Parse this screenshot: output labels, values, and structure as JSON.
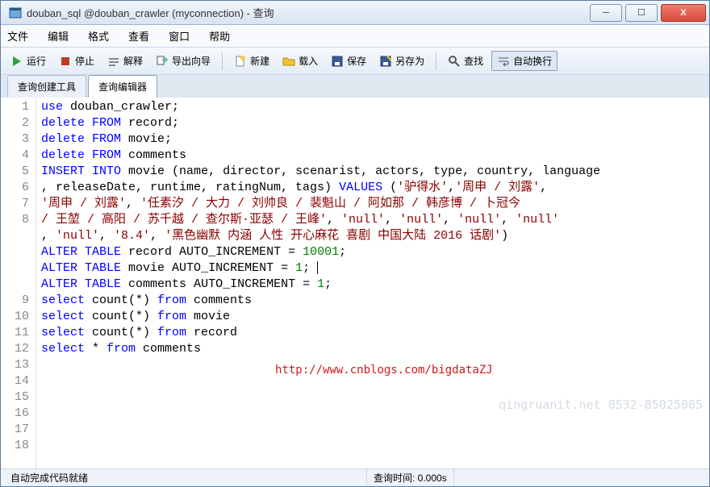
{
  "window": {
    "title": "douban_sql @douban_crawler (myconnection) - 查询"
  },
  "menu": {
    "file": "文件",
    "edit": "编辑",
    "format": "格式",
    "view": "查看",
    "window": "窗口",
    "help": "帮助"
  },
  "toolbar": {
    "run": "运行",
    "stop": "停止",
    "explain": "解释",
    "export_wizard": "导出向导",
    "new": "新建",
    "load": "载入",
    "save": "保存",
    "save_as": "另存为",
    "find": "查找",
    "auto_wrap": "自动换行"
  },
  "tabs": {
    "builder": "查询创建工具",
    "editor": "查询编辑器"
  },
  "code": {
    "lines": [
      [
        {
          "t": "kw",
          "v": "use"
        },
        {
          "t": "id",
          "v": " douban_crawler;"
        }
      ],
      [
        {
          "t": "kw",
          "v": "delete"
        },
        {
          "t": "id",
          "v": " "
        },
        {
          "t": "kw",
          "v": "FROM"
        },
        {
          "t": "id",
          "v": " record;"
        }
      ],
      [
        {
          "t": "kw",
          "v": "delete"
        },
        {
          "t": "id",
          "v": " "
        },
        {
          "t": "kw",
          "v": "FROM"
        },
        {
          "t": "id",
          "v": " movie;"
        }
      ],
      [
        {
          "t": "kw",
          "v": "delete"
        },
        {
          "t": "id",
          "v": " "
        },
        {
          "t": "kw",
          "v": "FROM"
        },
        {
          "t": "id",
          "v": " comments"
        }
      ],
      [
        {
          "t": "id",
          "v": ""
        }
      ],
      [
        {
          "t": "id",
          "v": ""
        }
      ],
      [
        {
          "t": "id",
          "v": ""
        }
      ],
      [
        {
          "t": "kw",
          "v": "INSERT"
        },
        {
          "t": "id",
          "v": " "
        },
        {
          "t": "kw",
          "v": "INTO"
        },
        {
          "t": "id",
          "v": " movie (name, director, scenarist, actors, type, country, language\n, releaseDate, runtime, ratingNum, tags) "
        },
        {
          "t": "kw",
          "v": "VALUES"
        },
        {
          "t": "id",
          "v": " ("
        },
        {
          "t": "str",
          "v": "'驴得水'"
        },
        {
          "t": "id",
          "v": ","
        },
        {
          "t": "str",
          "v": "'周申 / 刘露'"
        },
        {
          "t": "id",
          "v": ",\n"
        },
        {
          "t": "str",
          "v": "'周申 / 刘露'"
        },
        {
          "t": "id",
          "v": ", "
        },
        {
          "t": "str",
          "v": "'任素汐 / 大力 / 刘帅良 / 裴魁山 / 阿如那 / 韩彦博 / 卜冠今\n/ 王堃 / 高阳 / 苏千越 / 查尔斯·亚瑟 / 王峰'"
        },
        {
          "t": "id",
          "v": ", "
        },
        {
          "t": "str",
          "v": "'null'"
        },
        {
          "t": "id",
          "v": ", "
        },
        {
          "t": "str",
          "v": "'null'"
        },
        {
          "t": "id",
          "v": ", "
        },
        {
          "t": "str",
          "v": "'null'"
        },
        {
          "t": "id",
          "v": ", "
        },
        {
          "t": "str",
          "v": "'null'"
        },
        {
          "t": "id",
          "v": "\n, "
        },
        {
          "t": "str",
          "v": "'null'"
        },
        {
          "t": "id",
          "v": ", "
        },
        {
          "t": "str",
          "v": "'8.4'"
        },
        {
          "t": "id",
          "v": ", "
        },
        {
          "t": "str",
          "v": "'黑色幽默 内涵 人性 开心麻花 喜剧 中国大陆 2016 话剧'"
        },
        {
          "t": "id",
          "v": ")"
        }
      ],
      [
        {
          "t": "id",
          "v": ""
        }
      ],
      [
        {
          "t": "kw",
          "v": "ALTER"
        },
        {
          "t": "id",
          "v": " "
        },
        {
          "t": "kw",
          "v": "TABLE"
        },
        {
          "t": "id",
          "v": " record AUTO_INCREMENT = "
        },
        {
          "t": "num",
          "v": "10001"
        },
        {
          "t": "id",
          "v": ";"
        }
      ],
      [
        {
          "t": "kw",
          "v": "ALTER"
        },
        {
          "t": "id",
          "v": " "
        },
        {
          "t": "kw",
          "v": "TABLE"
        },
        {
          "t": "id",
          "v": " movie AUTO_INCREMENT = "
        },
        {
          "t": "num",
          "v": "1"
        },
        {
          "t": "id",
          "v": "; "
        },
        {
          "t": "cursor",
          "v": ""
        }
      ],
      [
        {
          "t": "kw",
          "v": "ALTER"
        },
        {
          "t": "id",
          "v": " "
        },
        {
          "t": "kw",
          "v": "TABLE"
        },
        {
          "t": "id",
          "v": " comments AUTO_INCREMENT = "
        },
        {
          "t": "num",
          "v": "1"
        },
        {
          "t": "id",
          "v": ";"
        }
      ],
      [
        {
          "t": "id",
          "v": ""
        }
      ],
      [
        {
          "t": "kw",
          "v": "select"
        },
        {
          "t": "id",
          "v": " count(*) "
        },
        {
          "t": "kw",
          "v": "from"
        },
        {
          "t": "id",
          "v": " comments"
        }
      ],
      [
        {
          "t": "kw",
          "v": "select"
        },
        {
          "t": "id",
          "v": " count(*) "
        },
        {
          "t": "kw",
          "v": "from"
        },
        {
          "t": "id",
          "v": " movie"
        }
      ],
      [
        {
          "t": "kw",
          "v": "select"
        },
        {
          "t": "id",
          "v": " count(*) "
        },
        {
          "t": "kw",
          "v": "from"
        },
        {
          "t": "id",
          "v": " record"
        }
      ],
      [
        {
          "t": "id",
          "v": ""
        }
      ],
      [
        {
          "t": "kw",
          "v": "select"
        },
        {
          "t": "id",
          "v": " * "
        },
        {
          "t": "kw",
          "v": "from"
        },
        {
          "t": "id",
          "v": " comments"
        }
      ]
    ],
    "line_numbers": [
      "1",
      "2",
      "3",
      "4",
      "5",
      "6",
      "7",
      "8",
      "",
      "",
      "",
      "",
      "9",
      "10",
      "11",
      "12",
      "13",
      "14",
      "15",
      "16",
      "17",
      "18"
    ]
  },
  "watermark": {
    "url": "http://www.cnblogs.com/bigdataZJ",
    "phone": "qingruanit.net 0532-85025005"
  },
  "status": {
    "left": "自动完成代码就绪",
    "right": "查询时间: 0.000s"
  }
}
